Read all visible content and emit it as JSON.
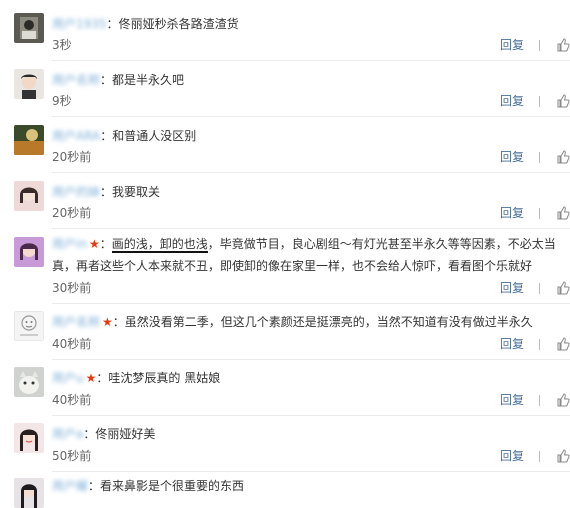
{
  "comments": [
    {
      "user": "用户1935",
      "vip": false,
      "text": "佟丽娅秒杀各路渣渣货",
      "time": "3秒",
      "reply": "回复"
    },
    {
      "user": "用户名称",
      "vip": false,
      "text": "都是半永久吧",
      "time": "9秒",
      "reply": "回复"
    },
    {
      "user": "用户ARA",
      "vip": false,
      "text": "和普通人没区别",
      "time": "20秒前",
      "reply": "回复"
    },
    {
      "user": "用户的妹",
      "vip": false,
      "text": "我要取关",
      "time": "20秒前",
      "reply": "回复"
    },
    {
      "user": "用户in",
      "vip": true,
      "text_a": "画的浅，卸的也浅",
      "text_b": "，毕竟做节目，良心剧组～有灯光甚至半永久等等因素，不必太当真，再者这些个人本来就不丑，即使卸的像在家里一样，也不会给人惊吓，看看图个乐就好",
      "time": "30秒前",
      "reply": "回复"
    },
    {
      "user": "用户名称",
      "vip": true,
      "text": "虽然没看第二季，但这几个素颜还是挺漂亮的，当然不知道有没有做过半永久",
      "time": "40秒前",
      "reply": "回复"
    },
    {
      "user": "用户u",
      "vip": true,
      "text": "哇沈梦辰真的 黑姑娘",
      "time": "40秒前",
      "reply": "回复"
    },
    {
      "user": "用户a",
      "vip": false,
      "text": "佟丽娅好美",
      "time": "50秒前",
      "reply": "回复"
    },
    {
      "user": "用户耀",
      "vip": false,
      "text": "看来鼻影是个很重要的东西",
      "time": "",
      "reply": ""
    }
  ]
}
